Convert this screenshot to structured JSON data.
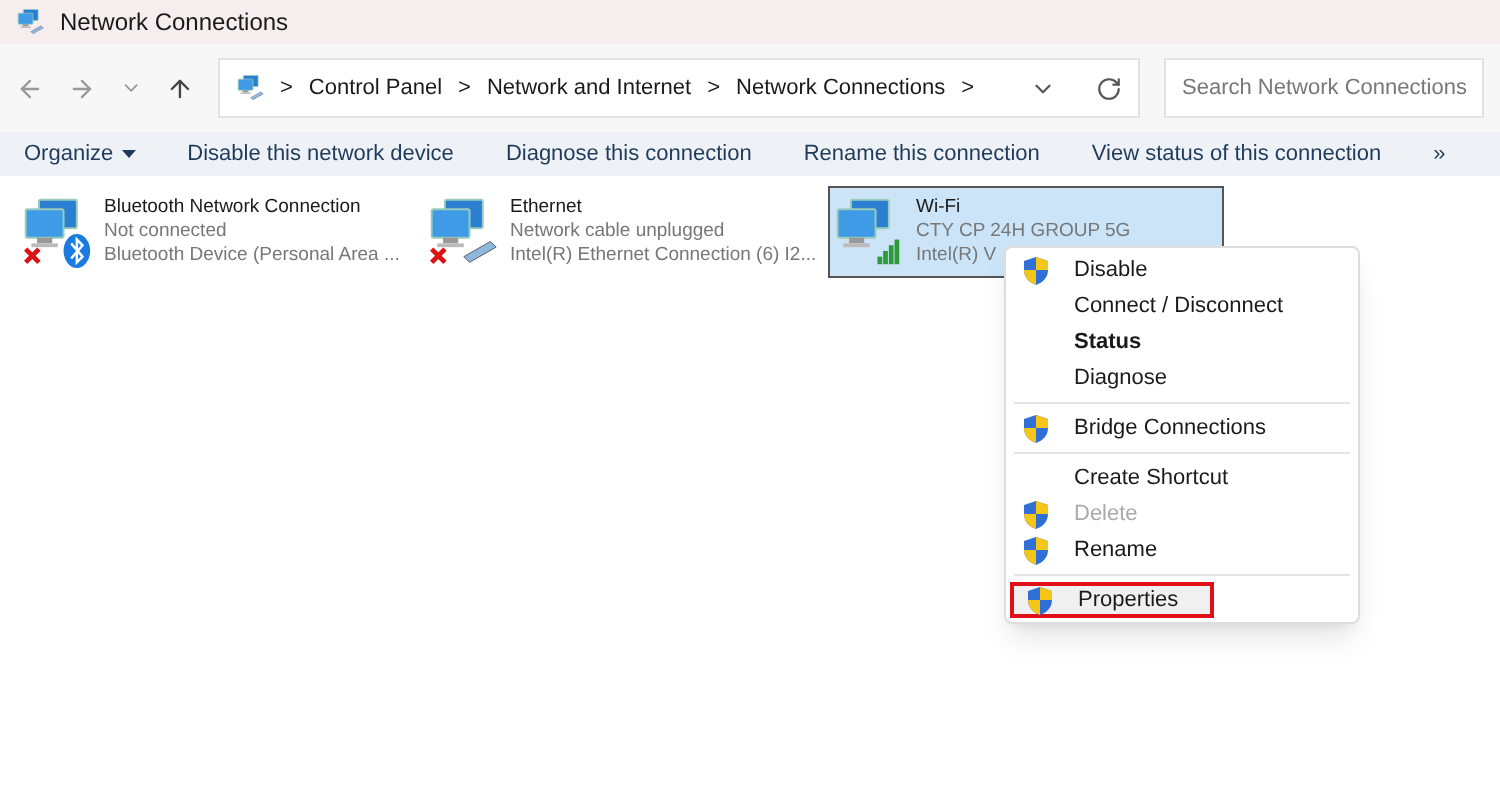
{
  "window": {
    "title": "Network Connections"
  },
  "breadcrumb": [
    "Control Panel",
    "Network and Internet",
    "Network Connections"
  ],
  "separator": ">",
  "search": {
    "placeholder": "Search Network Connections"
  },
  "commands": [
    {
      "label": "Organize",
      "dropdown": true
    },
    {
      "label": "Disable this network device",
      "dropdown": false
    },
    {
      "label": "Diagnose this connection",
      "dropdown": false
    },
    {
      "label": "Rename this connection",
      "dropdown": false
    },
    {
      "label": "View status of this connection",
      "dropdown": false
    }
  ],
  "more": "»",
  "connections": [
    {
      "kind": "bluetooth",
      "name": "Bluetooth Network Connection",
      "status": "Not connected",
      "device": "Bluetooth Device (Personal Area ...",
      "disconnected": true,
      "selected": false
    },
    {
      "kind": "ethernet",
      "name": "Ethernet",
      "status": "Network cable unplugged",
      "device": "Intel(R) Ethernet Connection (6) I2...",
      "disconnected": true,
      "selected": false
    },
    {
      "kind": "wifi",
      "name": "Wi-Fi",
      "status": "CTY CP 24H GROUP 5G",
      "device": "Intel(R) V",
      "disconnected": false,
      "selected": true
    }
  ],
  "context_menu": [
    {
      "kind": "item",
      "label": "Disable",
      "shield": true,
      "bold": false,
      "disabled": false,
      "highlighted": false
    },
    {
      "kind": "item",
      "label": "Connect / Disconnect",
      "shield": false,
      "bold": false,
      "disabled": false,
      "highlighted": false
    },
    {
      "kind": "item",
      "label": "Status",
      "shield": false,
      "bold": true,
      "disabled": false,
      "highlighted": false
    },
    {
      "kind": "item",
      "label": "Diagnose",
      "shield": false,
      "bold": false,
      "disabled": false,
      "highlighted": false
    },
    {
      "kind": "separator"
    },
    {
      "kind": "item",
      "label": "Bridge Connections",
      "shield": true,
      "bold": false,
      "disabled": false,
      "highlighted": false
    },
    {
      "kind": "separator"
    },
    {
      "kind": "item",
      "label": "Create Shortcut",
      "shield": false,
      "bold": false,
      "disabled": false,
      "highlighted": false
    },
    {
      "kind": "item",
      "label": "Delete",
      "shield": true,
      "bold": false,
      "disabled": true,
      "highlighted": false
    },
    {
      "kind": "item",
      "label": "Rename",
      "shield": true,
      "bold": false,
      "disabled": false,
      "highlighted": false
    },
    {
      "kind": "separator"
    },
    {
      "kind": "item",
      "label": "Properties",
      "shield": true,
      "bold": false,
      "disabled": false,
      "highlighted": true
    }
  ]
}
